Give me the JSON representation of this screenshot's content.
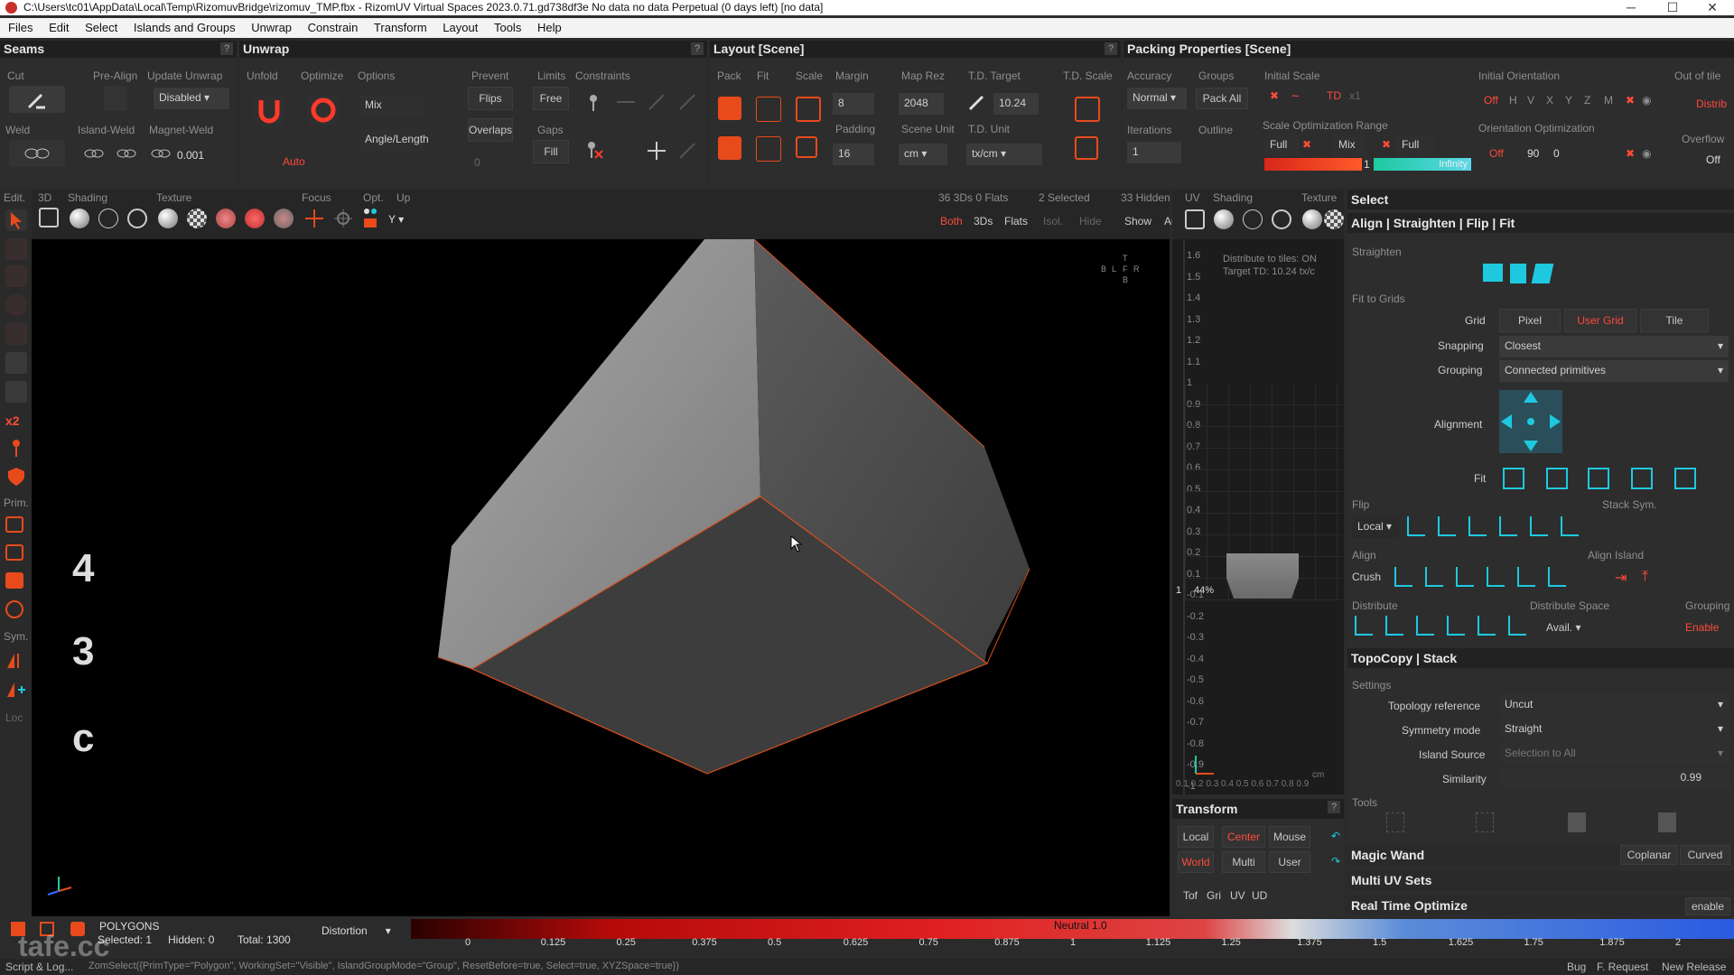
{
  "window": {
    "title": "C:\\Users\\tc01\\AppData\\Local\\Temp\\RizomuvBridge\\rizomuv_TMP.fbx - RizomUV  Virtual Spaces 2023.0.71.gd738df3e No data no data Perpetual  (0 days left) [no data]",
    "minimize": "─",
    "maximize": "☐",
    "close": "✕"
  },
  "menu": [
    "Files",
    "Edit",
    "Select",
    "Islands and Groups",
    "Unwrap",
    "Constrain",
    "Transform",
    "Layout",
    "Tools",
    "Help"
  ],
  "seams": {
    "title": "Seams",
    "cut": "Cut",
    "prealign": "Pre-Align",
    "update_unwrap": "Update Unwrap",
    "update_value": "Disabled",
    "weld": "Weld",
    "island_weld": "Island-Weld",
    "magnet_weld": "Magnet-Weld",
    "magnet_value": "0.001"
  },
  "unwrap": {
    "title": "Unwrap",
    "unfold": "Unfold",
    "optimize": "Optimize",
    "options": "Options",
    "mix": "Mix",
    "angle_length": "Angle/Length",
    "auto": "Auto",
    "prevent": "Prevent",
    "flips": "Flips",
    "overlaps": "Overlaps",
    "overlaps_value": "0",
    "limits": "Limits",
    "free": "Free",
    "gaps": "Gaps",
    "fill": "Fill",
    "constraints": "Constraints"
  },
  "layout": {
    "title": "Layout [Scene]",
    "pack": "Pack",
    "fit": "Fit",
    "scale": "Scale",
    "margin": "Margin",
    "margin_value": "8",
    "padding": "Padding",
    "padding_value": "16",
    "map_rez": "Map Rez",
    "map_rez_value": "2048",
    "scene_unit": "Scene Unit",
    "scene_unit_value": "cm",
    "td_target": "T.D. Target",
    "td_target_value": "10.24",
    "td_unit": "T.D. Unit",
    "td_unit_value": "tx/cm",
    "td_scale": "T.D. Scale"
  },
  "packing": {
    "title": "Packing Properties [Scene]",
    "accuracy": "Accuracy",
    "accuracy_value": "Normal",
    "groups": "Groups",
    "pack_all": "Pack All",
    "iterations": "Iterations",
    "iterations_value": "1",
    "outline": "Outline",
    "initial_scale": "Initial Scale",
    "td": "TD",
    "x1": "x1",
    "scale_opt_range": "Scale Optimization Range",
    "full1": "Full",
    "mix": "Mix",
    "full2": "Full",
    "range_low": "1",
    "range_high": "Infinity",
    "initial_orientation": "Initial Orientation",
    "off1": "Off",
    "axes": [
      "H",
      "V",
      "X",
      "Y",
      "Z",
      "M"
    ],
    "orientation_opt": "Orientation Optimization",
    "off2": "Off",
    "angle1": "90",
    "angle2": "0",
    "out_of_tile": "Out of tile",
    "distrib": "Distrib",
    "overflow": "Overflow",
    "overflow_value": "Off"
  },
  "view3d": {
    "edit": "Edit.",
    "three_d": "3D",
    "shading": "Shading",
    "texture": "Texture",
    "focus": "Focus",
    "opt": "Opt.",
    "up": "Up",
    "up_value": "Y",
    "stats": "36 3Ds 0 Flats",
    "selected": "2 Selected",
    "hidden": "33 Hidden",
    "both": "Both",
    "threeds": "3Ds",
    "flats": "Flats",
    "isol": "Isol.",
    "hide": "Hide",
    "show": "Show",
    "auto": "Auto",
    "side_labels": [
      "4",
      "3",
      "c"
    ],
    "left_labels": [
      "Prim.",
      "Sym.",
      "Loc"
    ],
    "x2": "x2",
    "mini_axes": [
      "T",
      "B",
      "L",
      "F",
      "R",
      "B"
    ]
  },
  "uv": {
    "uv": "UV",
    "shading": "Shading",
    "texture": "Texture",
    "distribute": "Distribute to tiles: ON",
    "target_td": "Target TD: 10.24 tx/c",
    "zoom": "44%",
    "one": "1",
    "y_ticks": [
      "1.6",
      "1.5",
      "1.4",
      "1.3",
      "1.2",
      "1.1",
      "1",
      "0.9",
      "0.8",
      "0.7",
      "0.6",
      "0.5",
      "0.4",
      "0.3",
      "0.2",
      "0.1",
      "-0.1",
      "-0.2",
      "-0.3",
      "-0.4",
      "-0.5",
      "-0.6",
      "-0.7",
      "-0.8",
      "-0.9",
      "-1"
    ],
    "x_ticks": "0.1 0.2 0.3 0.4 0.5 0.6 0.7 0.8 0.9",
    "cm": "cm"
  },
  "transform": {
    "title": "Transform",
    "local": "Local",
    "center": "Center",
    "mouse": "Mouse",
    "world": "World",
    "multi": "Multi",
    "user": "User",
    "vtabs": [
      "Tof",
      "Gri",
      "UV",
      "UD"
    ]
  },
  "right": {
    "select": "Select",
    "align_title": "Align | Straighten | Flip | Fit",
    "straighten": "Straighten",
    "fit_to_grids": "Fit to Grids",
    "grid": "Grid",
    "pixel": "Pixel",
    "user_grid": "User Grid",
    "tile": "Tile",
    "snapping": "Snapping",
    "snapping_value": "Closest",
    "grouping": "Grouping",
    "grouping_value": "Connected primitives",
    "alignment": "Alignment",
    "fit": "Fit",
    "flip": "Flip",
    "flip_value": "Local",
    "stack_sym": "Stack Sym.",
    "align": "Align",
    "crush": "Crush",
    "align_island": "Align Island",
    "distribute": "Distribute",
    "distribute_space": "Distribute Space",
    "avail": "Avail.",
    "grouping2": "Grouping",
    "enable": "Enable",
    "topo_title": "TopoCopy | Stack",
    "settings": "Settings",
    "topo_ref": "Topology reference",
    "topo_ref_value": "Uncut",
    "sym_mode": "Symmetry mode",
    "sym_mode_value": "Straight",
    "island_source": "Island Source",
    "island_source_value": "Selection to All",
    "similarity": "Similarity",
    "similarity_value": "0.99",
    "tools": "Tools",
    "magic_wand": "Magic Wand",
    "coplanar": "Coplanar",
    "curved": "Curved",
    "multi_uv": "Multi UV Sets",
    "rto": "Real Time Optimize",
    "rto_enable": "enable"
  },
  "status": {
    "polygons": "POLYGONS",
    "selected": "Selected: 1",
    "hidden": "Hidden: 0",
    "total": "Total: 1300",
    "distortion": "Distortion",
    "neutral": "Neutral 1.0",
    "ticks": [
      "0",
      "0.125",
      "0.25",
      "0.375",
      "0.5",
      "0.625",
      "0.75",
      "0.875",
      "1",
      "1.125",
      "1.25",
      "1.375",
      "1.5",
      "1.625",
      "1.75",
      "1.875",
      "2"
    ],
    "script": "Script & Log...",
    "command": "ZomSelect({PrimType=\"Polygon\", WorkingSet=\"Visible\", IslandGroupMode=\"Group\", ResetBefore=true, Select=true, XYZSpace=true})",
    "bug": "Bug",
    "freq": "F. Request",
    "newrel": "New Release",
    "watermark": "tafe.cc"
  },
  "colors": {
    "accent_red": "#ff4a3a",
    "accent_cyan": "#1ec9e0",
    "panel": "#2d2d2d",
    "viewport": "#000000"
  }
}
